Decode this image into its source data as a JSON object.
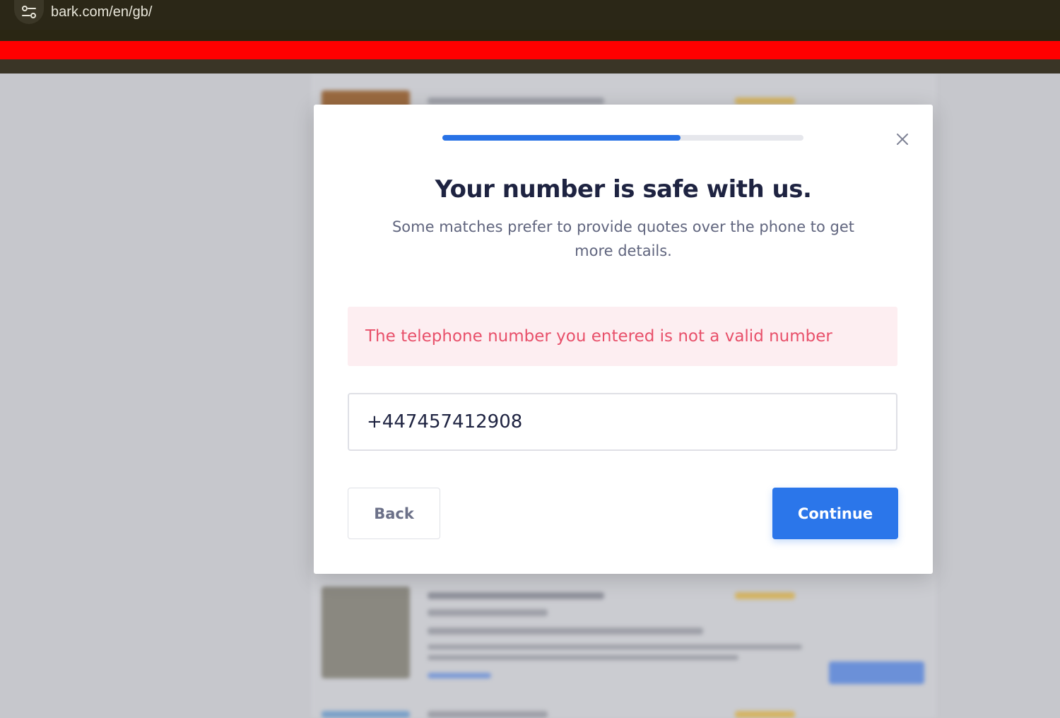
{
  "browser": {
    "url": "bark.com/en/gb/",
    "site_info_icon": "tune-icon",
    "highlight_color": "#ff0000"
  },
  "modal": {
    "progress_fraction": 0.66,
    "close_icon": "close-icon",
    "title": "Your number is safe with us.",
    "subtitle": "Some matches prefer to provide quotes over the phone to get more details.",
    "error_message": "The telephone number you entered is not a valid number",
    "phone_value": "+447457412908",
    "back_label": "Back",
    "continue_label": "Continue",
    "colors": {
      "accent": "#2b76ea",
      "error_text": "#e8506a",
      "error_bg": "#fdeef1",
      "title": "#1e2341"
    }
  }
}
